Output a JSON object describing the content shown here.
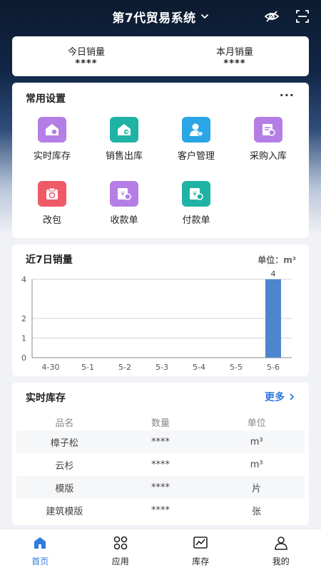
{
  "header": {
    "title": "第7代贸易系统"
  },
  "sales": {
    "today_label": "今日销量",
    "today_value": "****",
    "month_label": "本月销量",
    "month_value": "****"
  },
  "settings": {
    "title": "常用设置",
    "more": "···",
    "items": [
      {
        "label": "实时库存",
        "icon": "warehouse-icon",
        "color": "#b57ee6"
      },
      {
        "label": "销售出库",
        "icon": "outbound-icon",
        "color": "#1fb3a5"
      },
      {
        "label": "客户管理",
        "icon": "customer-icon",
        "color": "#2aa5e6"
      },
      {
        "label": "采购入库",
        "icon": "purchase-icon",
        "color": "#b57ee6"
      },
      {
        "label": "改包",
        "icon": "repack-icon",
        "color": "#ef5a67"
      },
      {
        "label": "收款单",
        "icon": "receipt-icon",
        "color": "#b57ee6"
      },
      {
        "label": "付款单",
        "icon": "payment-icon",
        "color": "#1fb3a5"
      }
    ]
  },
  "chart_title": "近7日销量",
  "chart_unit": "单位：m³",
  "chart_data": {
    "type": "bar",
    "categories": [
      "4-30",
      "5-1",
      "5-2",
      "5-3",
      "5-4",
      "5-5",
      "5-6"
    ],
    "values": [
      0,
      0,
      0,
      0,
      0,
      0,
      4
    ],
    "ylim": [
      0,
      4
    ],
    "yticks": [
      "0",
      "1",
      "2",
      "4"
    ],
    "data_labels": [
      "",
      "",
      "",
      "",
      "",
      "",
      "4"
    ],
    "grid": true,
    "bar_color": "#4d86cc"
  },
  "stock": {
    "title": "实时库存",
    "more": "更多",
    "headers": [
      "品名",
      "数量",
      "单位"
    ],
    "rows": [
      [
        "樟子松",
        "****",
        "m³"
      ],
      [
        "云杉",
        "****",
        "m³"
      ],
      [
        "模版",
        "****",
        "片"
      ],
      [
        "建筑模版",
        "****",
        "张"
      ]
    ]
  },
  "tabs": [
    {
      "label": "首页",
      "icon": "home-icon"
    },
    {
      "label": "应用",
      "icon": "apps-icon"
    },
    {
      "label": "库存",
      "icon": "inventory-chart-icon"
    },
    {
      "label": "我的",
      "icon": "profile-icon"
    }
  ],
  "colors": {
    "accent": "#2f7ae0"
  }
}
